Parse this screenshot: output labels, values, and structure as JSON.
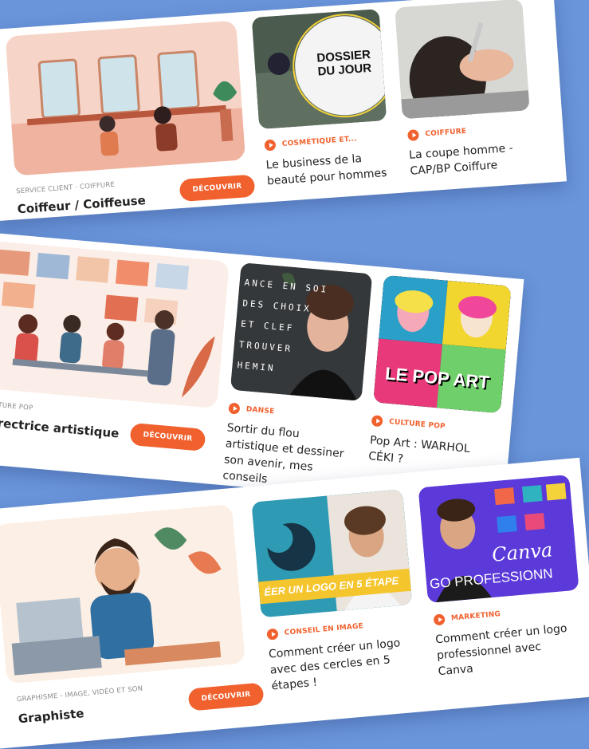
{
  "cards": [
    {
      "feature": {
        "breadcrumb": "SERVICE CLIENT · COIFFURE",
        "title": "Coiffeur / Coiffeuse",
        "cta": "DÉCOUVRIR"
      },
      "items": [
        {
          "tag": "COSMÉTIQUE ET...",
          "title": "Le business de la beauté pour hommes",
          "overlay": "DOSSIER DU JOUR"
        },
        {
          "tag": "COIFFURE",
          "title": "La coupe homme - CAP/BP Coiffure"
        }
      ]
    },
    {
      "feature": {
        "breadcrumb": "CULTURE POP",
        "title": "Directrice artistique",
        "cta": "DÉCOUVRIR"
      },
      "items": [
        {
          "tag": "DANSE",
          "title": "Sortir du flou artistique et dessiner son avenir, mes conseils",
          "overlay_lines": [
            "ANCE EN SOI",
            "DES CHOIX",
            "ET CLEF",
            "TROUVER",
            "HEMIN"
          ]
        },
        {
          "tag": "CULTURE POP",
          "title": "Pop Art : WARHOL CÉKI ?",
          "overlay": "LE POP ART"
        }
      ]
    },
    {
      "feature": {
        "breadcrumb": "GRAPHISME - IMAGE, VIDÉO ET SON",
        "title": "Graphiste",
        "cta": "DÉCOUVRIR"
      },
      "items": [
        {
          "tag": "CONSEIL EN IMAGE",
          "title": "Comment créer un logo avec des cercles en 5 étapes !",
          "overlay": "ÉER UN LOGO EN 5 ÉTAPE"
        },
        {
          "tag": "MARKETING",
          "title": "Comment créer un logo professionnel avec Canva",
          "overlay": "Canva",
          "overlay2": "GO PROFESSIONN"
        }
      ]
    }
  ],
  "colors": {
    "accent": "#f0612e",
    "background": "#6a95db"
  }
}
